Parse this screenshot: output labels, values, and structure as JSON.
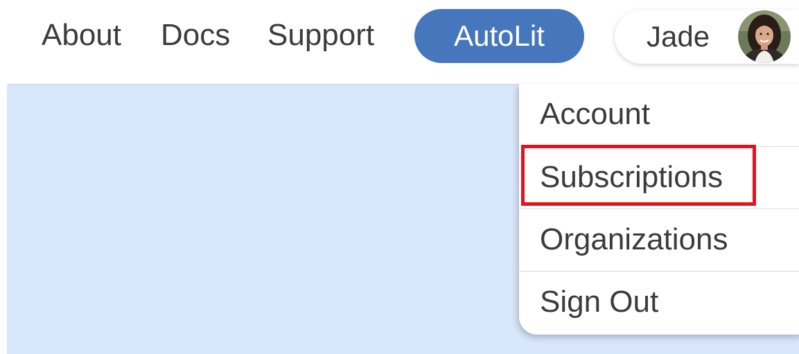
{
  "nav": {
    "links": [
      "About",
      "Docs",
      "Support"
    ],
    "autolit_label": "AutoLit",
    "user_name": "Jade",
    "avatar_icon": "user-avatar-photo"
  },
  "dropdown": {
    "items": [
      "Account",
      "Subscriptions",
      "Organizations",
      "Sign Out"
    ],
    "highlighted_item": "Subscriptions"
  },
  "colors": {
    "accent": "#4677bd",
    "content_background": "#d8e6fb",
    "highlight": "#e0141e"
  }
}
